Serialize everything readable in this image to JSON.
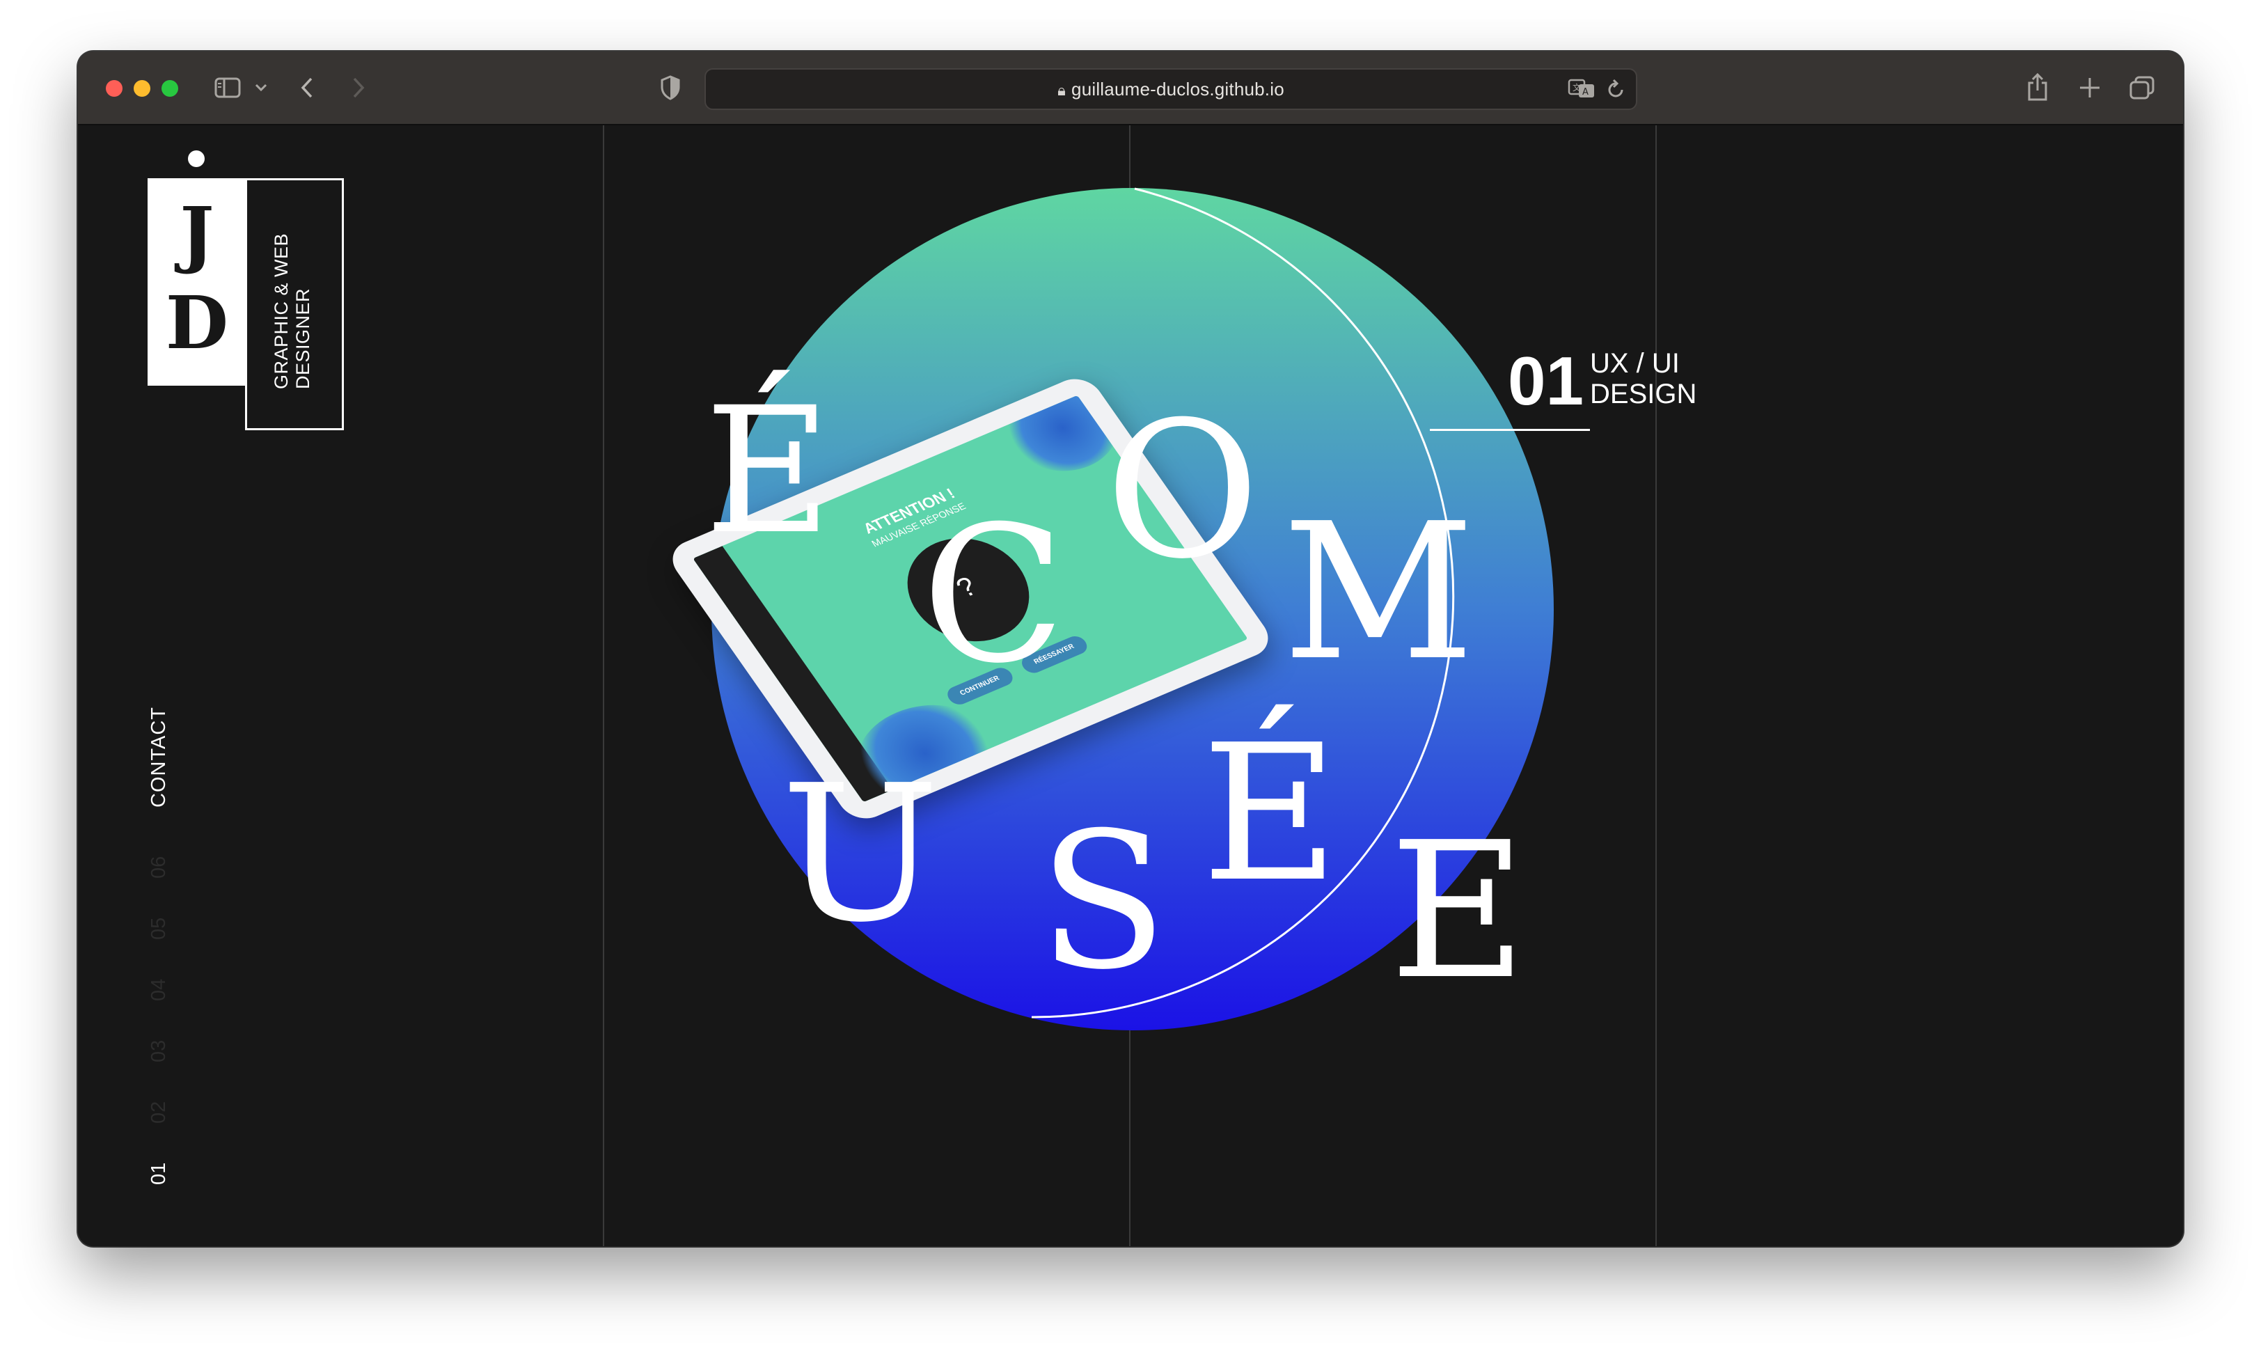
{
  "browser": {
    "url": "guillaume-duclos.github.io",
    "traffic_colors": [
      "#ff5f57",
      "#febc2e",
      "#28c840"
    ]
  },
  "logo": {
    "letters": "JD",
    "tagline_line1": "GRAPHIC & WEB",
    "tagline_line2": "DESIGNER"
  },
  "nav": {
    "contact": "CONTACT",
    "items": [
      "06",
      "05",
      "04",
      "03",
      "02",
      "01"
    ],
    "active": "01"
  },
  "project": {
    "number": "01",
    "category_line1": "UX / UI",
    "category_line2": "DESIGN",
    "title_line1": [
      "É",
      "C",
      "O",
      "M"
    ],
    "title_line2": [
      "U",
      "S",
      "É",
      "E"
    ]
  },
  "tablet": {
    "alert_title": "ATTENTION !",
    "alert_subtitle": "MAUVAISE RÉPONSE",
    "center_symbol": "?",
    "button_continue": "CONTINUER",
    "button_retry": "RÉESSAYER"
  },
  "colors": {
    "gradient_top": "#5fd6a2",
    "gradient_bottom": "#1b16e6",
    "background": "#171717",
    "tablet_screen": "#5dd4ab"
  }
}
